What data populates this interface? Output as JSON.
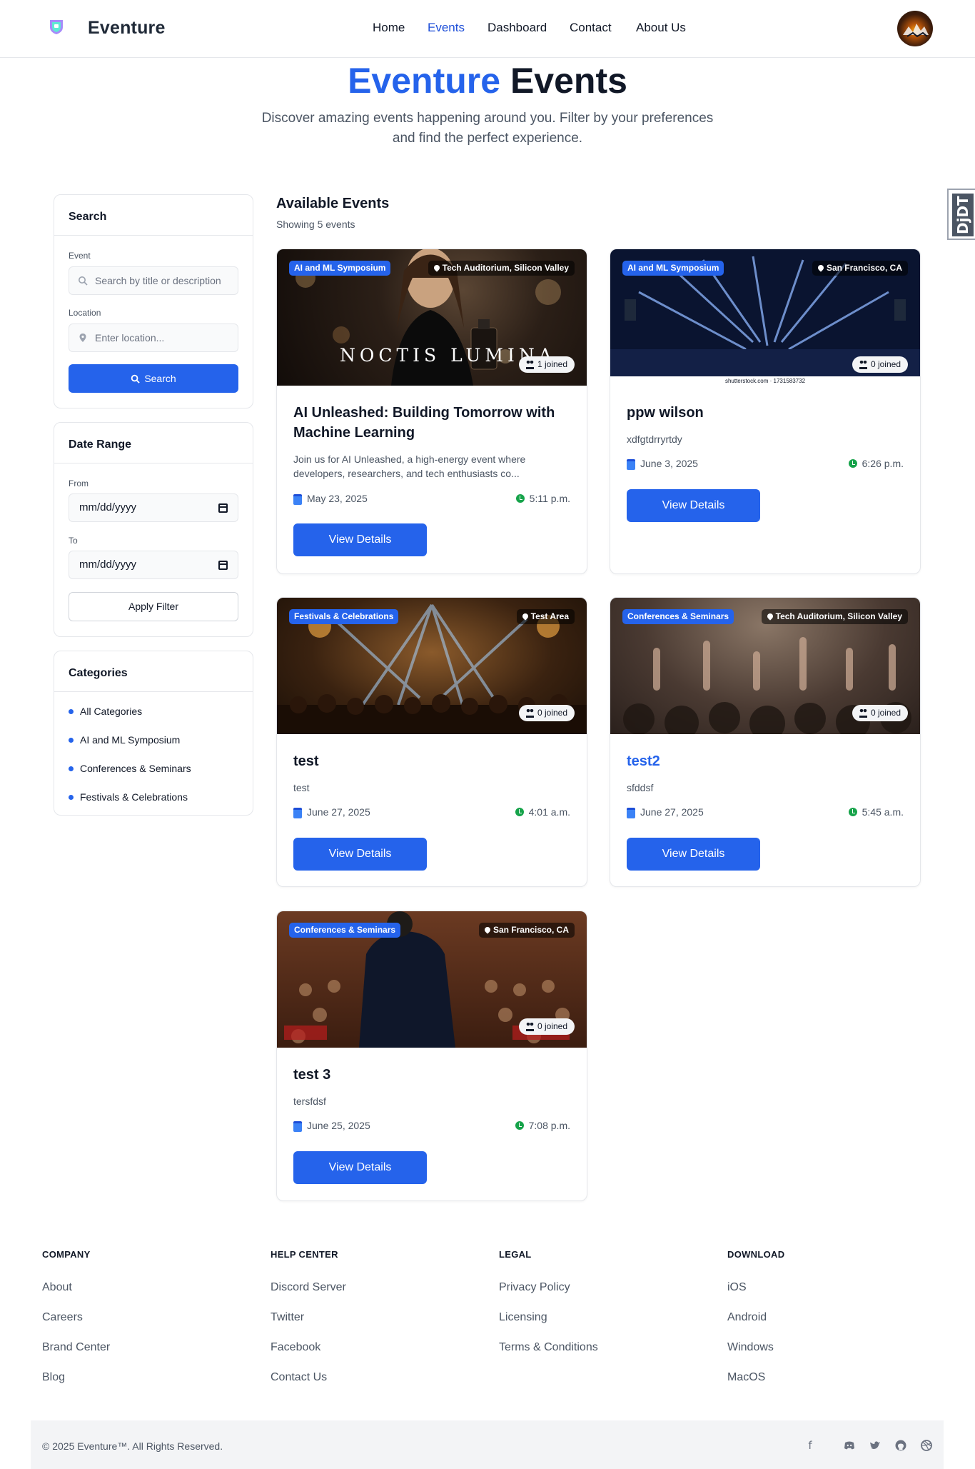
{
  "header": {
    "brand": "Eventure",
    "nav": [
      "Home",
      "Events",
      "Dashboard",
      "Contact",
      "About Us"
    ],
    "active_nav": "Events"
  },
  "hero": {
    "title_accent": "Eventure",
    "title_rest": "Events",
    "subtitle_line1": "Discover amazing events happening around you. Filter by your preferences",
    "subtitle_line2": "and find the perfect experience."
  },
  "sidebar": {
    "search": {
      "title": "Search",
      "event_label": "Event",
      "event_placeholder": "Search by title or description",
      "location_label": "Location",
      "location_placeholder": "Enter location...",
      "button": "Search"
    },
    "date_range": {
      "title": "Date Range",
      "from_label": "From",
      "from_value": "mm/dd/yyyy",
      "to_label": "To",
      "to_value": "mm/dd/yyyy",
      "button": "Apply Filter"
    },
    "categories": {
      "title": "Categories",
      "items": [
        "All Categories",
        "AI and ML Symposium",
        "Conferences & Seminars",
        "Festivals & Celebrations"
      ]
    }
  },
  "events_section": {
    "title": "Available Events",
    "count_text": "Showing 5 events"
  },
  "events": [
    {
      "category": "AI and ML Symposium",
      "location": "Tech Auditorium, Silicon Valley",
      "joined": "1 joined",
      "title_line1": "AI Unleashed: Building Tomorrow with",
      "title_line2": "Machine Learning",
      "description_line1": "Join us for AI Unleashed, a high-energy event where",
      "description_line2": "developers, researchers, and tech enthusiasts co...",
      "date": "May 23, 2025",
      "time": "5:11 p.m.",
      "button": "View Details",
      "image_text": "NOCTIS LUMINA"
    },
    {
      "category": "AI and ML Symposium",
      "location": "San Francisco, CA",
      "joined": "0 joined",
      "title": "ppw wilson",
      "description": "xdfgtdrryrtdy",
      "date": "June 3, 2025",
      "time": "6:26 p.m.",
      "button": "View Details",
      "image_text": "shutterstock.com · 1731583732"
    },
    {
      "category": "Festivals & Celebrations",
      "location": "Test Area",
      "joined": "0 joined",
      "title": "test",
      "description": "test",
      "date": "June 27, 2025",
      "time": "4:01 a.m.",
      "button": "View Details"
    },
    {
      "category": "Conferences & Seminars",
      "location": "Tech Auditorium, Silicon Valley",
      "joined": "0 joined",
      "title": "test2",
      "description": "sfddsf",
      "date": "June 27, 2025",
      "time": "5:45 a.m.",
      "button": "View Details"
    },
    {
      "category": "Conferences & Seminars",
      "location": "San Francisco, CA",
      "joined": "0 joined",
      "title": "test 3",
      "description": "tersfdsf",
      "date": "June 25, 2025",
      "time": "7:08 p.m.",
      "button": "View Details"
    }
  ],
  "footer": {
    "columns": [
      {
        "heading": "COMPANY",
        "links": [
          "About",
          "Careers",
          "Brand Center",
          "Blog"
        ]
      },
      {
        "heading": "HELP CENTER",
        "links": [
          "Discord Server",
          "Twitter",
          "Facebook",
          "Contact Us"
        ]
      },
      {
        "heading": "LEGAL",
        "links": [
          "Privacy Policy",
          "Licensing",
          "Terms & Conditions"
        ]
      },
      {
        "heading": "DOWNLOAD",
        "links": [
          "iOS",
          "Android",
          "Windows",
          "MacOS"
        ]
      }
    ],
    "copyright": "© 2025 Eventure™. All Rights Reserved.",
    "social_icons": [
      "facebook-icon",
      "discord-icon",
      "twitter-icon",
      "github-icon",
      "dribbble-icon"
    ]
  },
  "devtools_badge": "DjDT",
  "colors": {
    "primary": "#2563eb",
    "text": "#111827",
    "muted": "#4b5563",
    "success": "#16a34a"
  }
}
